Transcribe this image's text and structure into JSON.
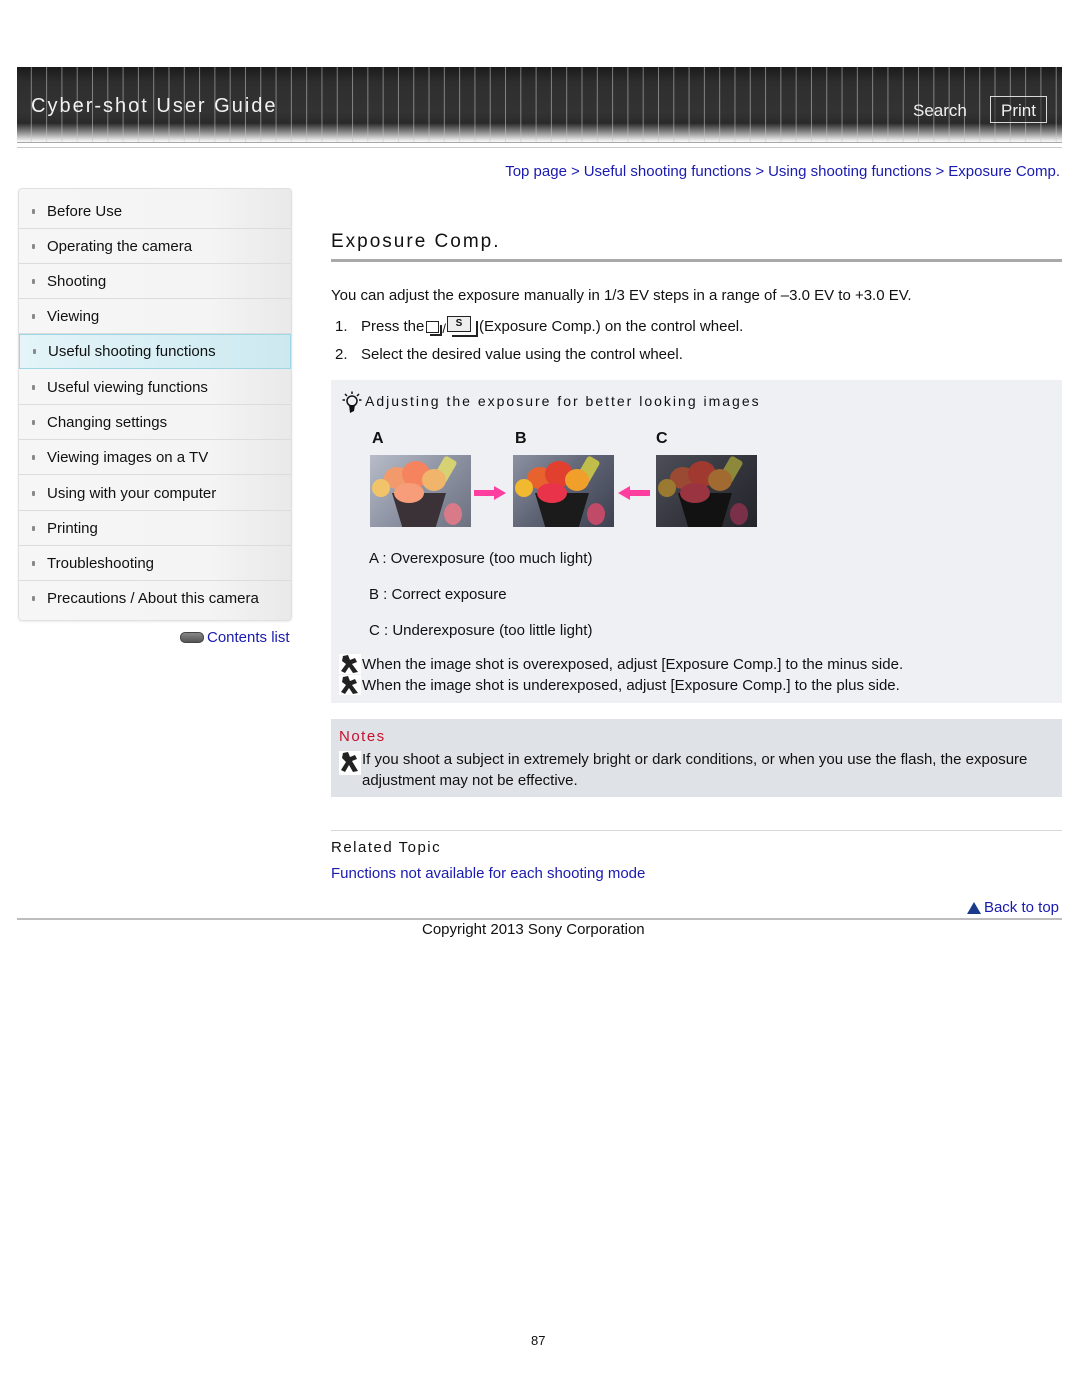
{
  "header": {
    "title": "Cyber-shot User Guide",
    "search_label": "Search",
    "print_label": "Print"
  },
  "breadcrumb": [
    {
      "label": "Top page"
    },
    {
      "label": "Useful shooting functions"
    },
    {
      "label": "Using shooting functions"
    },
    {
      "label": "Exposure Comp."
    }
  ],
  "breadcrumb_separator": ">",
  "sidebar": {
    "items": [
      {
        "label": "Before Use",
        "active": false
      },
      {
        "label": "Operating the camera",
        "active": false
      },
      {
        "label": "Shooting",
        "active": false
      },
      {
        "label": "Viewing",
        "active": false
      },
      {
        "label": "Useful shooting functions",
        "active": true
      },
      {
        "label": "Useful viewing functions",
        "active": false
      },
      {
        "label": "Changing settings",
        "active": false
      },
      {
        "label": "Viewing images on a TV",
        "active": false
      },
      {
        "label": "Using with your computer",
        "active": false
      },
      {
        "label": "Printing",
        "active": false
      },
      {
        "label": "Troubleshooting",
        "active": false
      },
      {
        "label": "Precautions / About this camera",
        "active": false
      }
    ],
    "contents_list_label": "Contents list"
  },
  "main": {
    "title": "Exposure Comp.",
    "intro": "You can adjust the exposure manually in 1/3 EV steps in a range of –3.0 EV to +3.0 EV.",
    "steps": [
      {
        "num": "1.",
        "before": "Press the",
        "icon": "exposure-comp-button-icon",
        "after": "(Exposure Comp.) on the control wheel."
      },
      {
        "num": "2.",
        "text": "Select the desired value using the control wheel."
      }
    ],
    "tip": {
      "title": "Adjusting the exposure for better looking images",
      "images": [
        {
          "label": "A",
          "kind": "overexposed"
        },
        {
          "label": "B",
          "kind": "correct"
        },
        {
          "label": "C",
          "kind": "underexposed"
        }
      ],
      "legend": [
        "A : Overexposure (too much light)",
        "B : Correct exposure",
        "C : Underexposure (too little light)"
      ],
      "hints": [
        "When the image shot is overexposed, adjust [Exposure Comp.] to the minus side.",
        "When the image shot is underexposed, adjust [Exposure Comp.] to the plus side."
      ]
    },
    "notes": {
      "title": "Notes",
      "text": "If you shoot a subject in extremely bright or dark conditions, or when you use the flash, the exposure adjustment may not be effective."
    },
    "related": {
      "title": "Related Topic",
      "links": [
        "Functions not available for each shooting mode"
      ]
    },
    "back_to_top": "Back to top"
  },
  "footer": {
    "copyright": "Copyright 2013 Sony Corporation",
    "page_number": "87"
  },
  "colors": {
    "link": "#1a1ab0",
    "notes_title": "#c8102e",
    "active_nav": "#d5eef4",
    "arrow": "#ff3ea0"
  }
}
